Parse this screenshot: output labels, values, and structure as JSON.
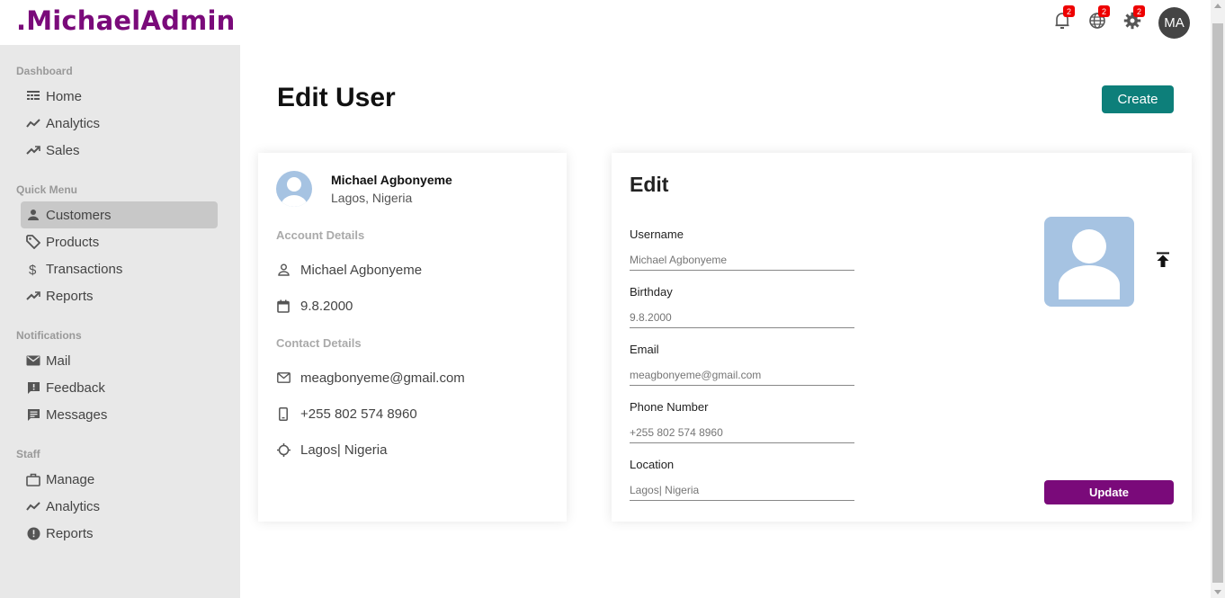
{
  "brand": {
    "logo_text": ".MichaelAdmin",
    "color": "#7a0a7a"
  },
  "topbar": {
    "notifications": {
      "icon": "bell-icon",
      "badge": "2"
    },
    "language": {
      "icon": "globe-icon",
      "badge": "2"
    },
    "settings": {
      "icon": "gear-icon",
      "badge": "2"
    },
    "avatar_initials": "MA"
  },
  "sidebar": {
    "sections": [
      {
        "title": "Dashboard",
        "items": [
          {
            "label": "Home",
            "icon": "home-icon"
          },
          {
            "label": "Analytics",
            "icon": "timeline-icon"
          },
          {
            "label": "Sales",
            "icon": "trending-up-icon"
          }
        ]
      },
      {
        "title": "Quick Menu",
        "items": [
          {
            "label": "Customers",
            "icon": "person-icon",
            "active": true
          },
          {
            "label": "Products",
            "icon": "tag-icon"
          },
          {
            "label": "Transactions",
            "icon": "dollar-icon"
          },
          {
            "label": "Reports",
            "icon": "trending-up-icon"
          }
        ]
      },
      {
        "title": "Notifications",
        "items": [
          {
            "label": "Mail",
            "icon": "mail-icon"
          },
          {
            "label": "Feedback",
            "icon": "feedback-icon"
          },
          {
            "label": "Messages",
            "icon": "chat-icon"
          }
        ]
      },
      {
        "title": "Staff",
        "items": [
          {
            "label": "Manage",
            "icon": "briefcase-icon"
          },
          {
            "label": "Analytics",
            "icon": "timeline-icon"
          },
          {
            "label": "Reports",
            "icon": "error-icon"
          }
        ]
      }
    ]
  },
  "main": {
    "title": "Edit User",
    "create_button": "Create",
    "accent_color": "#0d7f7a"
  },
  "user_show": {
    "name": "Michael Agbonyeme",
    "location": "Lagos, Nigeria",
    "account_title": "Account Details",
    "username": "Michael Agbonyeme",
    "birthday": "9.8.2000",
    "contact_title": "Contact Details",
    "email": "meagbonyeme@gmail.com",
    "phone": "+255 802 574 8960",
    "address": "Lagos| Nigeria"
  },
  "user_edit": {
    "title": "Edit",
    "fields": [
      {
        "label": "Username",
        "placeholder": "Michael Agbonyeme"
      },
      {
        "label": "Birthday",
        "placeholder": "9.8.2000"
      },
      {
        "label": "Email",
        "placeholder": "meagbonyeme@gmail.com"
      },
      {
        "label": "Phone Number",
        "placeholder": "+255 802 574 8960"
      },
      {
        "label": "Location",
        "placeholder": "Lagos| Nigeria"
      }
    ],
    "upload_icon": "upload-icon",
    "update_button": "Update",
    "update_color": "#7a0a7a"
  }
}
